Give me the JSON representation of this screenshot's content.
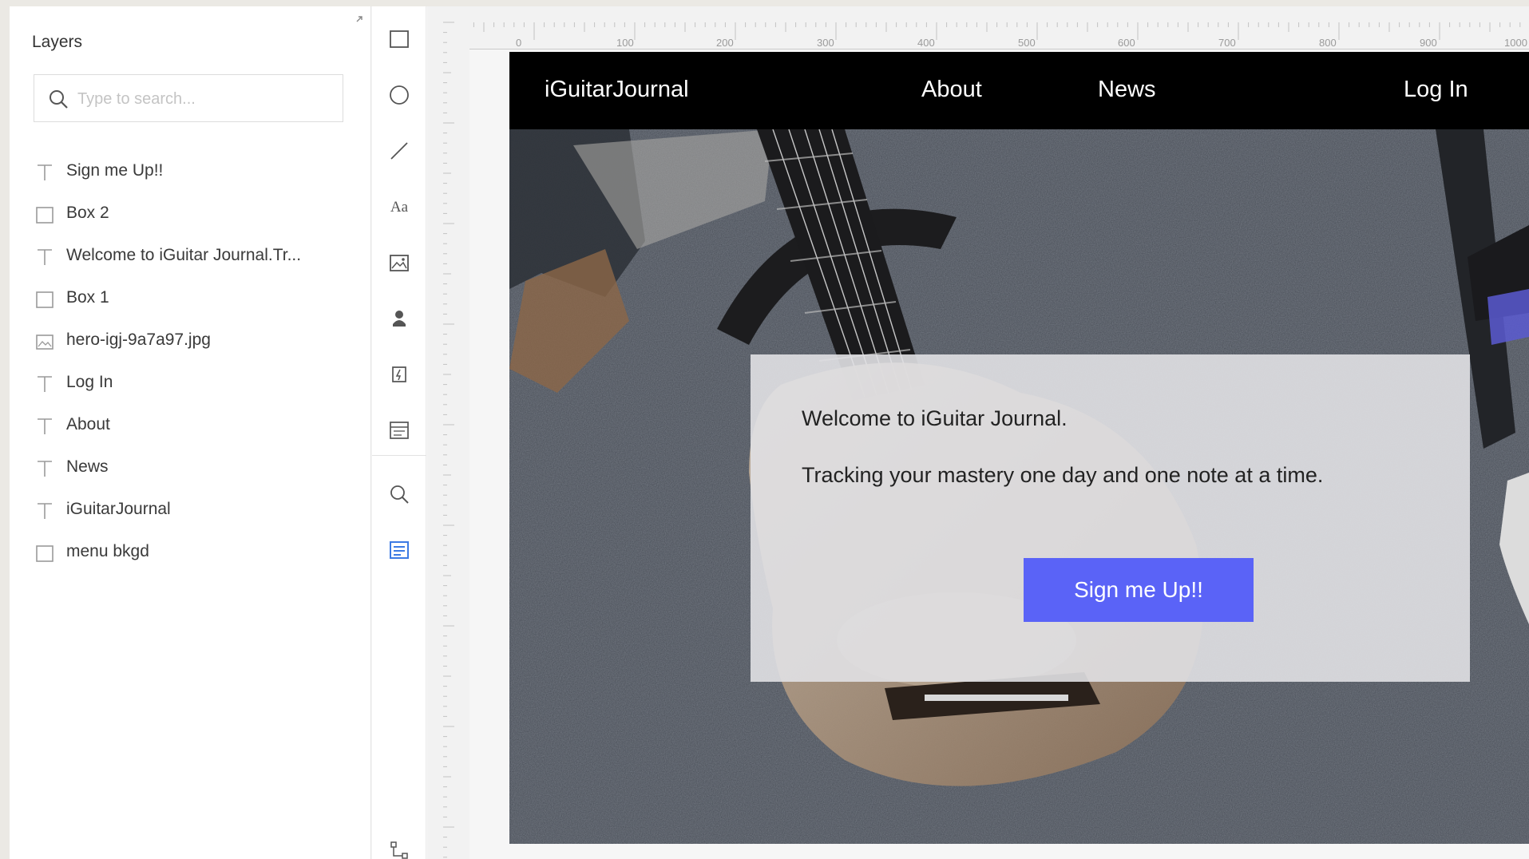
{
  "layers_panel": {
    "title": "Layers",
    "search_placeholder": "Type to search...",
    "items": [
      {
        "type": "text",
        "icon": "text-layer-icon",
        "label": "Sign me Up!!"
      },
      {
        "type": "rect",
        "icon": "rectangle-layer-icon",
        "label": "Box 2"
      },
      {
        "type": "text",
        "icon": "text-layer-icon",
        "label": "Welcome to iGuitar Journal.Tr..."
      },
      {
        "type": "rect",
        "icon": "rectangle-layer-icon",
        "label": "Box 1"
      },
      {
        "type": "image",
        "icon": "image-layer-icon",
        "label": "hero-igj-9a7a97.jpg"
      },
      {
        "type": "text",
        "icon": "text-layer-icon",
        "label": "Log In"
      },
      {
        "type": "text",
        "icon": "text-layer-icon",
        "label": "About"
      },
      {
        "type": "text",
        "icon": "text-layer-icon",
        "label": "News"
      },
      {
        "type": "text",
        "icon": "text-layer-icon",
        "label": "iGuitarJournal"
      },
      {
        "type": "rect",
        "icon": "rectangle-layer-icon",
        "label": "menu bkgd"
      }
    ]
  },
  "toolbar": {
    "tools": [
      {
        "name": "rectangle-tool",
        "icon": "rectangle-icon"
      },
      {
        "name": "ellipse-tool",
        "icon": "ellipse-icon"
      },
      {
        "name": "line-tool",
        "icon": "line-icon"
      },
      {
        "name": "text-tool",
        "icon": "text-icon"
      },
      {
        "name": "image-tool",
        "icon": "image-icon"
      },
      {
        "name": "component-tool",
        "icon": "component-icon"
      },
      {
        "name": "export-tool",
        "icon": "export-icon"
      },
      {
        "name": "grid-tool",
        "icon": "grid-icon"
      },
      {
        "name": "zoom-tool",
        "icon": "zoom-icon"
      },
      {
        "name": "layers-tool",
        "icon": "layers-icon",
        "active": true
      },
      {
        "name": "links-tool",
        "icon": "links-icon"
      }
    ],
    "text_tool_glyph": "Aa"
  },
  "rulers": {
    "horizontal_labels": [
      "0",
      "100",
      "200",
      "300",
      "400",
      "500",
      "600",
      "700",
      "800",
      "900",
      "1000"
    ],
    "vertical_labels": [
      "0",
      "100",
      "200",
      "300",
      "400",
      "500",
      "600",
      "700",
      "800"
    ]
  },
  "artboard": {
    "site_title": "iGuitarJournal",
    "nav": {
      "about": "About",
      "news": "News",
      "login": "Log In"
    },
    "welcome": "Welcome to iGuitar Journal.",
    "tagline": "Tracking your mastery one day and one note at a time.",
    "cta_label": "Sign me Up!!"
  },
  "colors": {
    "accent": "#5a63f7",
    "menu_background": "#000000",
    "panel_background": "#ffffff",
    "active_tool": "#3d7be4"
  }
}
